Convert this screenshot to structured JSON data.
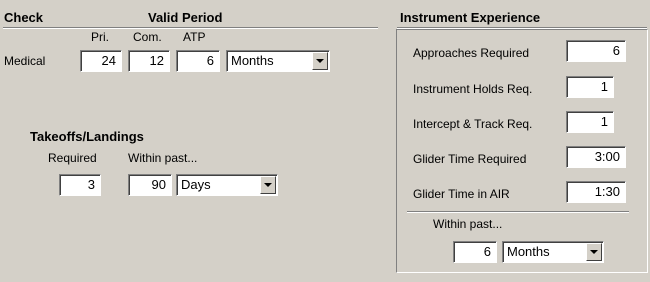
{
  "check_section": {
    "check_header": "Check",
    "valid_period_header": "Valid Period",
    "col_pri": "Pri.",
    "col_com": "Com.",
    "col_atp": "ATP",
    "medical_label": "Medical",
    "medical_pri": "24",
    "medical_com": "12",
    "medical_atp": "6",
    "medical_unit": "Months"
  },
  "takeoffs": {
    "title": "Takeoffs/Landings",
    "required_label": "Required",
    "within_label": "Within past...",
    "required_value": "3",
    "within_value": "90",
    "within_unit": "Days"
  },
  "instrument": {
    "title": "Instrument Experience",
    "rows": [
      {
        "label": "Approaches Required",
        "value": "6"
      },
      {
        "label": "Instrument Holds Req.",
        "value": "1"
      },
      {
        "label": "Intercept & Track Req.",
        "value": "1"
      },
      {
        "label": "Glider Time Required",
        "value": "3:00"
      },
      {
        "label": "Glider Time in AIR",
        "value": "1:30"
      }
    ],
    "within_label": "Within past...",
    "within_value": "6",
    "within_unit": "Months"
  }
}
